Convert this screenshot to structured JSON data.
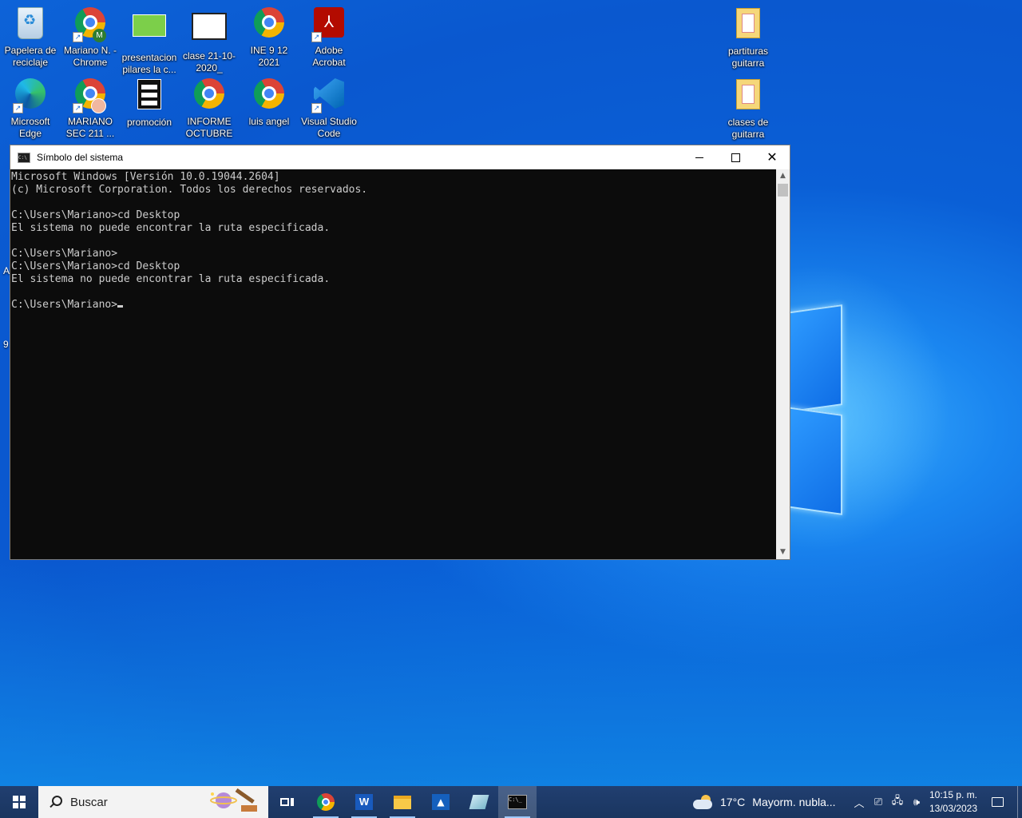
{
  "desktop": {
    "icons": [
      {
        "label": "Papelera de reciclaje",
        "kind": "recycle-bin"
      },
      {
        "label": "Mariano N. - Chrome",
        "kind": "chrome-profile"
      },
      {
        "label": "presentacion pilares la c...",
        "kind": "image-file"
      },
      {
        "label": "clase 21-10-2020_",
        "kind": "image-file"
      },
      {
        "label": "INE 9 12 2021",
        "kind": "chrome"
      },
      {
        "label": "Adobe Acrobat",
        "kind": "acrobat"
      },
      {
        "label": "partituras guitarra",
        "kind": "folder"
      },
      {
        "label": "Microsoft Edge",
        "kind": "edge"
      },
      {
        "label": "MARIANO SEC 211 ...",
        "kind": "chrome-profile"
      },
      {
        "label": "promoción",
        "kind": "video-file"
      },
      {
        "label": "INFORME OCTUBRE",
        "kind": "chrome"
      },
      {
        "label": "luis angel",
        "kind": "chrome"
      },
      {
        "label": "Visual Studio Code",
        "kind": "vscode"
      },
      {
        "label": "clases de guitarra",
        "kind": "folder"
      }
    ],
    "partial_labels": [
      "A",
      "9"
    ]
  },
  "console_window": {
    "title": "Símbolo del sistema",
    "lines": [
      "Microsoft Windows [Versión 10.0.19044.2604]",
      "(c) Microsoft Corporation. Todos los derechos reservados.",
      "",
      "C:\\Users\\Mariano>cd Desktop",
      "El sistema no puede encontrar la ruta especificada.",
      "",
      "C:\\Users\\Mariano>",
      "C:\\Users\\Mariano>cd Desktop",
      "El sistema no puede encontrar la ruta especificada.",
      "",
      "C:\\Users\\Mariano>"
    ],
    "buttons": {
      "minimize": "minimize",
      "maximize": "maximize",
      "close": "close"
    }
  },
  "taskbar": {
    "search_placeholder": "Buscar",
    "apps": [
      "Google Chrome",
      "Microsoft Word",
      "Explorador de archivos",
      "App",
      "App",
      "Símbolo del sistema"
    ],
    "weather": {
      "temp": "17°C",
      "text": "Mayorm. nubla..."
    },
    "clock": {
      "time": "10:15 p. m.",
      "date": "13/03/2023"
    }
  },
  "colors": {
    "console_bg": "#0c0c0c",
    "console_fg": "#cccccc",
    "taskbar_bg": "#1b3a6b",
    "desktop_bg": "#0a5fd6"
  }
}
